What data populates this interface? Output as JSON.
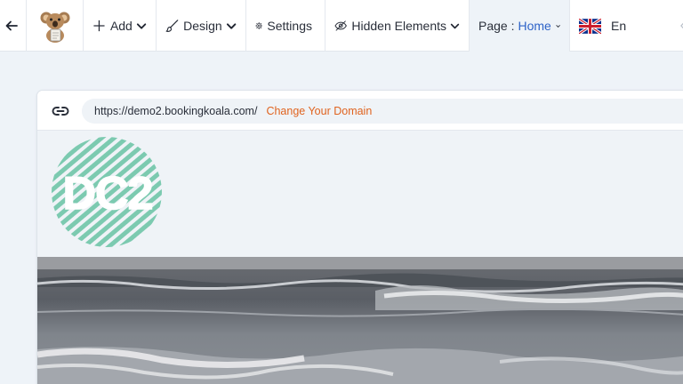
{
  "toolbar": {
    "back_icon": "arrow-left-icon",
    "logo_icon": "koala-logo",
    "add": {
      "label": "Add",
      "icon": "plus-icon"
    },
    "design": {
      "label": "Design",
      "icon": "brush-icon"
    },
    "settings": {
      "label": "Settings",
      "icon": "gear-icon"
    },
    "hidden": {
      "label": "Hidden Elements",
      "icon": "eye-slash-icon"
    },
    "page": {
      "label": "Page :",
      "value": "Home"
    },
    "language": {
      "label": "En",
      "icon": "uk-flag-icon"
    }
  },
  "preview": {
    "url": "https://demo2.bookingkoala.com/",
    "change_domain": "Change Your Domain",
    "site_logo_text": "DC2"
  },
  "colors": {
    "accent_link": "#e0631f",
    "page_value": "#2e63c8",
    "logo_teal": "#7ccab0",
    "background": "#eef3f8"
  }
}
